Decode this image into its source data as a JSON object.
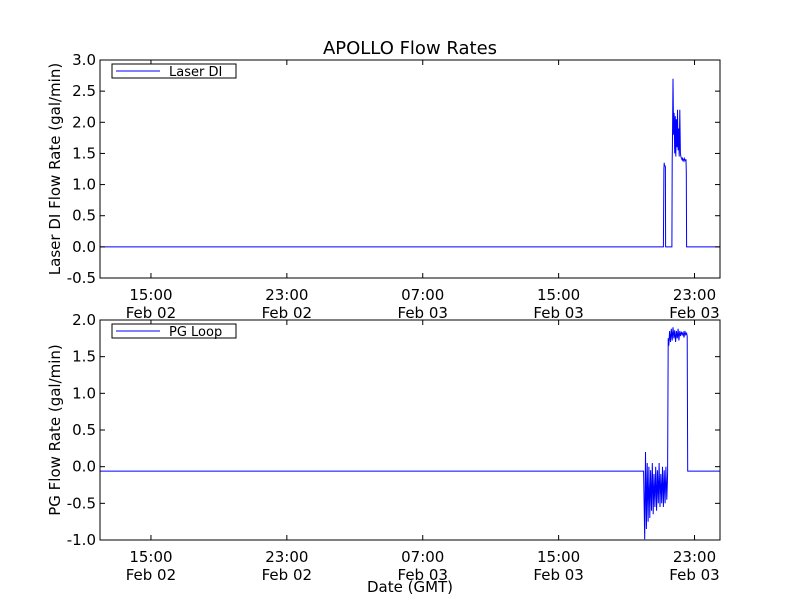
{
  "chart_data": [
    {
      "type": "line",
      "title": "APOLLO Flow Rates",
      "xlabel": "",
      "ylabel": "Laser DI Flow Rate (gal/min)",
      "xlim": [
        "2012-02-02 12:00",
        "2012-02-04 00:30"
      ],
      "ylim": [
        -0.5,
        3.0
      ],
      "grid": false,
      "legend_position": "top-left",
      "x_ticks": [
        {
          "x": "2012-02-02 15:00",
          "time": "15:00",
          "date": "Feb 02"
        },
        {
          "x": "2012-02-02 23:00",
          "time": "23:00",
          "date": "Feb 02"
        },
        {
          "x": "2012-02-03 07:00",
          "time": "07:00",
          "date": "Feb 03"
        },
        {
          "x": "2012-02-03 15:00",
          "time": "15:00",
          "date": "Feb 03"
        },
        {
          "x": "2012-02-03 23:00",
          "time": "23:00",
          "date": "Feb 03"
        }
      ],
      "y_ticks": [
        "-0.5",
        "0.0",
        "0.5",
        "1.0",
        "1.5",
        "2.0",
        "2.5",
        "3.0"
      ],
      "series": [
        {
          "name": "Laser DI",
          "color": "#0000ff",
          "x": [
            "2012-02-02 12:00",
            "2012-02-03 21:10",
            "2012-02-03 21:12",
            "2012-02-03 21:13",
            "2012-02-03 21:14",
            "2012-02-03 21:16",
            "2012-02-03 21:17",
            "2012-02-03 21:18",
            "2012-02-03 21:40",
            "2012-02-03 21:41",
            "2012-02-03 21:42",
            "2012-02-03 21:44",
            "2012-02-03 21:46",
            "2012-02-03 21:48",
            "2012-02-03 21:50",
            "2012-02-03 21:52",
            "2012-02-03 21:54",
            "2012-02-03 21:56",
            "2012-02-03 21:58",
            "2012-02-03 22:00",
            "2012-02-03 22:02",
            "2012-02-03 22:04",
            "2012-02-03 22:06",
            "2012-02-03 22:08",
            "2012-02-03 22:10",
            "2012-02-03 22:12",
            "2012-02-03 22:14",
            "2012-02-03 22:16",
            "2012-02-03 22:18",
            "2012-02-03 22:20",
            "2012-02-03 22:22",
            "2012-02-03 22:24",
            "2012-02-03 22:26",
            "2012-02-03 22:28",
            "2012-02-03 22:30",
            "2012-02-03 22:31",
            "2012-02-03 22:32",
            "2012-02-04 00:30"
          ],
          "values": [
            0.0,
            0.0,
            1.25,
            1.35,
            1.3,
            1.3,
            1.28,
            0.0,
            0.0,
            1.4,
            1.6,
            2.7,
            1.8,
            2.15,
            1.5,
            2.1,
            1.45,
            2.05,
            1.6,
            2.2,
            1.55,
            1.9,
            1.45,
            2.2,
            1.5,
            1.45,
            1.42,
            1.4,
            1.42,
            1.38,
            1.4,
            1.42,
            1.38,
            1.4,
            1.4,
            1.2,
            0.0,
            0.0
          ]
        }
      ]
    },
    {
      "type": "line",
      "title": "",
      "xlabel": "Date (GMT)",
      "ylabel": "PG Flow Rate (gal/min)",
      "xlim": [
        "2012-02-02 12:00",
        "2012-02-04 00:30"
      ],
      "ylim": [
        -1.0,
        2.0
      ],
      "grid": false,
      "legend_position": "top-left",
      "x_ticks": [
        {
          "x": "2012-02-02 15:00",
          "time": "15:00",
          "date": "Feb 02"
        },
        {
          "x": "2012-02-02 23:00",
          "time": "23:00",
          "date": "Feb 02"
        },
        {
          "x": "2012-02-03 07:00",
          "time": "07:00",
          "date": "Feb 03"
        },
        {
          "x": "2012-02-03 15:00",
          "time": "15:00",
          "date": "Feb 03"
        },
        {
          "x": "2012-02-03 23:00",
          "time": "23:00",
          "date": "Feb 03"
        }
      ],
      "y_ticks": [
        "-1.0",
        "-0.5",
        "0.0",
        "0.5",
        "1.0",
        "1.5",
        "2.0"
      ],
      "series": [
        {
          "name": "PG Loop",
          "color": "#0000ff",
          "x": [
            "2012-02-02 12:00",
            "2012-02-03 20:00",
            "2012-02-03 20:04",
            "2012-02-03 20:07",
            "2012-02-03 20:10",
            "2012-02-03 20:13",
            "2012-02-03 20:16",
            "2012-02-03 20:19",
            "2012-02-03 20:22",
            "2012-02-03 20:25",
            "2012-02-03 20:28",
            "2012-02-03 20:31",
            "2012-02-03 20:34",
            "2012-02-03 20:37",
            "2012-02-03 20:40",
            "2012-02-03 20:43",
            "2012-02-03 20:46",
            "2012-02-03 20:49",
            "2012-02-03 20:52",
            "2012-02-03 20:55",
            "2012-02-03 20:58",
            "2012-02-03 21:01",
            "2012-02-03 21:04",
            "2012-02-03 21:07",
            "2012-02-03 21:10",
            "2012-02-03 21:13",
            "2012-02-03 21:16",
            "2012-02-03 21:19",
            "2012-02-03 21:22",
            "2012-02-03 21:25",
            "2012-02-03 21:27",
            "2012-02-03 21:29",
            "2012-02-03 21:32",
            "2012-02-03 21:35",
            "2012-02-03 21:38",
            "2012-02-03 21:41",
            "2012-02-03 21:44",
            "2012-02-03 21:47",
            "2012-02-03 21:50",
            "2012-02-03 21:53",
            "2012-02-03 21:56",
            "2012-02-03 21:59",
            "2012-02-03 22:02",
            "2012-02-03 22:05",
            "2012-02-03 22:08",
            "2012-02-03 22:11",
            "2012-02-03 22:14",
            "2012-02-03 22:17",
            "2012-02-03 22:20",
            "2012-02-03 22:23",
            "2012-02-03 22:26",
            "2012-02-03 22:29",
            "2012-02-03 22:32",
            "2012-02-03 22:34",
            "2012-02-03 22:36",
            "2012-02-04 00:30"
          ],
          "values": [
            -0.06,
            -0.06,
            -0.99,
            0.2,
            -0.85,
            0.05,
            -0.75,
            0.0,
            -0.7,
            -0.05,
            -0.6,
            0.05,
            -0.65,
            -0.1,
            -0.55,
            0.0,
            -0.6,
            -0.05,
            -0.5,
            0.05,
            -0.55,
            -0.1,
            -0.5,
            0.0,
            -0.55,
            -0.05,
            -0.5,
            0.0,
            -0.45,
            -0.1,
            1.75,
            1.65,
            1.85,
            1.7,
            1.88,
            1.72,
            1.9,
            1.75,
            1.86,
            1.7,
            1.85,
            1.75,
            1.88,
            1.72,
            1.85,
            1.78,
            1.84,
            1.8,
            1.83,
            1.76,
            1.85,
            1.8,
            1.82,
            1.78,
            -0.06,
            -0.06
          ]
        }
      ]
    }
  ]
}
